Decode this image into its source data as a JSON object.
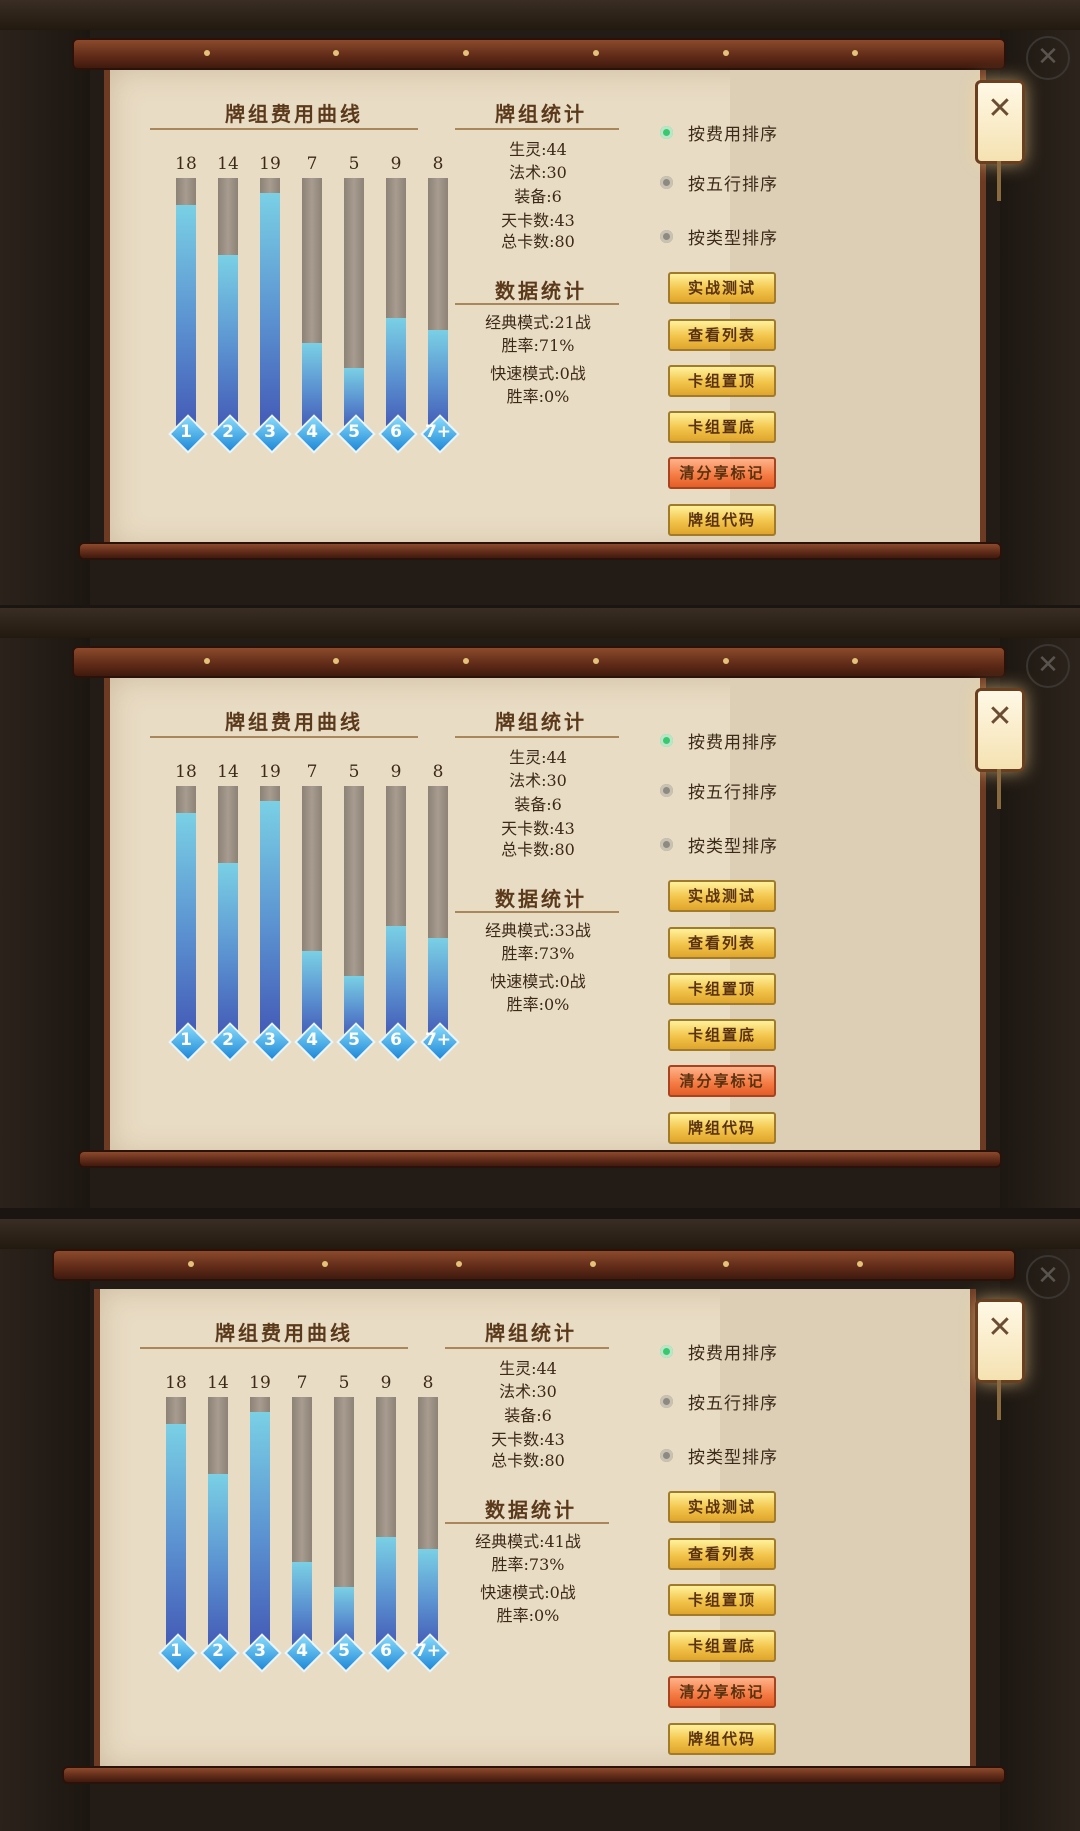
{
  "panels": [
    {
      "curve_title": "牌组费用曲线",
      "cost_curve": {
        "counts": [
          "18",
          "14",
          "19",
          "7",
          "5",
          "9",
          "8"
        ],
        "levels": [
          "1",
          "2",
          "3",
          "4",
          "5",
          "6",
          "7+"
        ],
        "max": 19
      },
      "deck_stats_title": "牌组统计",
      "deck_stats": [
        "生灵:44",
        "法术:30",
        "装备:6",
        "天卡数:43",
        "总卡数:80"
      ],
      "data_stats_title": "数据统计",
      "data_stats": [
        "经典模式:21战",
        "胜率:71%",
        "快速模式:0战",
        "胜率:0%"
      ],
      "sort_options": [
        "按费用排序",
        "按五行排序",
        "按类型排序"
      ],
      "buttons": [
        "实战测试",
        "查看列表",
        "卡组置顶",
        "卡组置底",
        "清分享标记",
        "牌组代码"
      ]
    },
    {
      "curve_title": "牌组费用曲线",
      "cost_curve": {
        "counts": [
          "18",
          "14",
          "19",
          "7",
          "5",
          "9",
          "8"
        ],
        "levels": [
          "1",
          "2",
          "3",
          "4",
          "5",
          "6",
          "7+"
        ],
        "max": 19
      },
      "deck_stats_title": "牌组统计",
      "deck_stats": [
        "生灵:44",
        "法术:30",
        "装备:6",
        "天卡数:43",
        "总卡数:80"
      ],
      "data_stats_title": "数据统计",
      "data_stats": [
        "经典模式:33战",
        "胜率:73%",
        "快速模式:0战",
        "胜率:0%"
      ],
      "sort_options": [
        "按费用排序",
        "按五行排序",
        "按类型排序"
      ],
      "buttons": [
        "实战测试",
        "查看列表",
        "卡组置顶",
        "卡组置底",
        "清分享标记",
        "牌组代码"
      ]
    },
    {
      "curve_title": "牌组费用曲线",
      "cost_curve": {
        "counts": [
          "18",
          "14",
          "19",
          "7",
          "5",
          "9",
          "8"
        ],
        "levels": [
          "1",
          "2",
          "3",
          "4",
          "5",
          "6",
          "7+"
        ],
        "max": 19
      },
      "deck_stats_title": "牌组统计",
      "deck_stats": [
        "生灵:44",
        "法术:30",
        "装备:6",
        "天卡数:43",
        "总卡数:80"
      ],
      "data_stats_title": "数据统计",
      "data_stats": [
        "经典模式:41战",
        "胜率:73%",
        "快速模式:0战",
        "胜率:0%"
      ],
      "sort_options": [
        "按费用排序",
        "按五行排序",
        "按类型排序"
      ],
      "buttons": [
        "实战测试",
        "查看列表",
        "卡组置顶",
        "卡组置底",
        "清分享标记",
        "牌组代码"
      ]
    }
  ],
  "selected_sort": "按费用排序",
  "colors": {
    "scroll_paper": "#e9dcc4",
    "rod": "#6d3a23",
    "bar_fill_top": "#7ad0e5",
    "bar_fill_bottom": "#4359b5",
    "button_gold": "#f2c44a",
    "button_orange": "#f47a42",
    "radio_selected": "#39c86e"
  },
  "icons": [
    "close-icon",
    "lantern-close-icon",
    "diamond-level-icon",
    "radio-dot-icon"
  ]
}
